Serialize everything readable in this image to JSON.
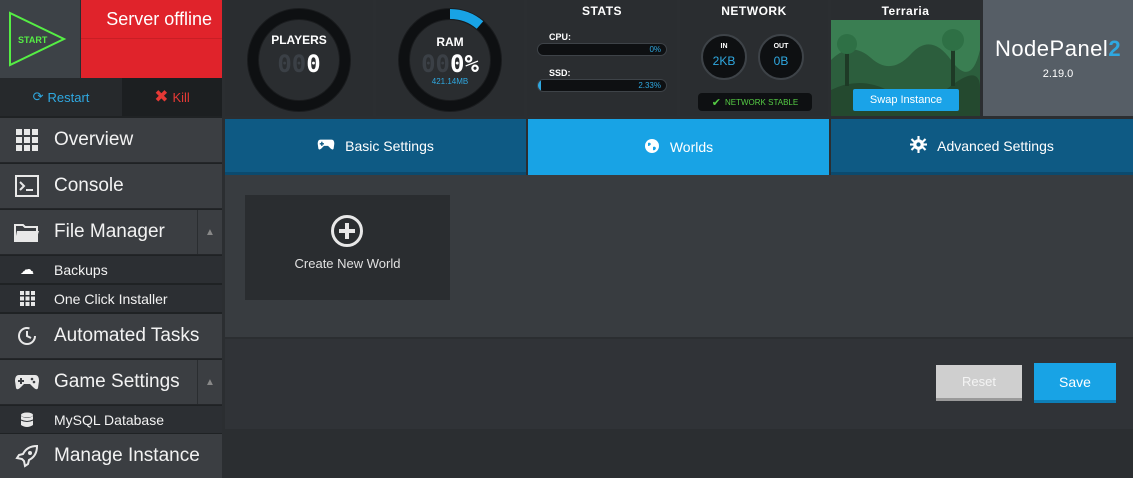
{
  "server": {
    "start_label": "START",
    "status": "Server offline",
    "restart_label": "Restart",
    "kill_label": "Kill"
  },
  "players": {
    "title": "PLAYERS",
    "ghost": "00",
    "value": "0"
  },
  "ram": {
    "title": "RAM",
    "ghost": "00",
    "value": "0%",
    "sub": "421.14MB"
  },
  "stats": {
    "title": "STATS",
    "cpu_label": "CPU:",
    "cpu_value": "0%",
    "cpu_fraction": 0.0,
    "ssd_label": "SSD:",
    "ssd_value": "2.33%",
    "ssd_fraction": 0.0233
  },
  "network": {
    "title": "NETWORK",
    "in_label": "IN",
    "in_value": "2KB",
    "out_label": "OUT",
    "out_value": "0B",
    "stable_label": "NETWORK STABLE"
  },
  "game": {
    "title": "Terraria",
    "swap_label": "Swap Instance"
  },
  "nodepanel": {
    "name": "NodePanel",
    "suffix": "2",
    "version": "2.19.0"
  },
  "sidebar": {
    "items": [
      {
        "label": "Overview"
      },
      {
        "label": "Console"
      },
      {
        "label": "File Manager"
      },
      {
        "label": "Backups"
      },
      {
        "label": "One Click Installer"
      },
      {
        "label": "Automated Tasks"
      },
      {
        "label": "Game Settings"
      },
      {
        "label": "MySQL Database"
      },
      {
        "label": "Manage Instance"
      }
    ]
  },
  "tabs": [
    {
      "label": "Basic Settings",
      "icon": "gamepad-icon"
    },
    {
      "label": "Worlds",
      "icon": "globe-icon"
    },
    {
      "label": "Advanced Settings",
      "icon": "gear-icon"
    }
  ],
  "worlds": {
    "create_label": "Create New World"
  },
  "actions": {
    "reset_label": "Reset",
    "save_label": "Save"
  },
  "colors": {
    "accent": "#18a3e5",
    "offline": "#e0232b",
    "start": "#55ee44"
  }
}
